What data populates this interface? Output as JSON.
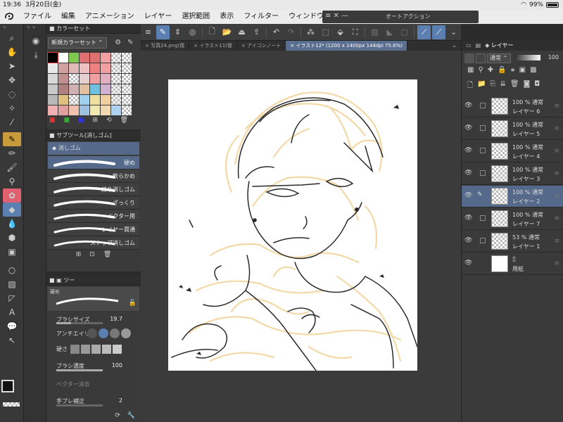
{
  "status": {
    "time": "19:36",
    "date": "3月20日(金)",
    "battery": "99%"
  },
  "menu": [
    "ファイル",
    "編集",
    "アニメーション",
    "レイヤー",
    "選択範囲",
    "表示",
    "フィルター",
    "ウィンドウ"
  ],
  "auto_action": {
    "title": "オートアクション"
  },
  "tabs": [
    {
      "label": "写真24.png(復",
      "active": false
    },
    {
      "label": "イラスト11(復",
      "active": false
    },
    {
      "label": "アイコンノート",
      "active": false
    },
    {
      "label": "イラスト12* (1200 x 1400px 144dpi 75.6%)",
      "active": true
    }
  ],
  "color_set": {
    "title": "カラーセット",
    "selected": "新規カラーセット",
    "swatches": [
      "#000000",
      "#ffffff",
      "#7ec850",
      "#e07070",
      "#e07070",
      "#f0a0a0",
      "checker",
      "checker",
      "#e8e8e8",
      "#d0a0a0",
      "#e0b8b8",
      "#f0c0c0",
      "#f08080",
      "#f0a0a0",
      "checker",
      "checker",
      "#d8d8d8",
      "#c09090",
      "checker",
      "#e8d0d0",
      "#f0a0a0",
      "#e0b0c0",
      "checker",
      "checker",
      "#c8c8c8",
      "#b08080",
      "#d0b0b0",
      "#e0c0a0",
      "#70c0e0",
      "#d0b0d0",
      "checker",
      "checker",
      "#b8b8b8",
      "#e0c080",
      "checker",
      "#a0d0f0",
      "#f0e0a0",
      "#f0d0a0",
      "checker",
      "checker",
      "#f0b0b0",
      "#e0a0a0",
      "#f0c0b0",
      "#a0c0e0",
      "#f0e8b0",
      "#f0d8b0",
      "#b0d0f0",
      "checker"
    ]
  },
  "sub_tool": {
    "title": "サブツール[消しゴム]",
    "group": "消しゴム",
    "items": [
      {
        "name": "硬め",
        "selected": true
      },
      {
        "name": "軟らかめ",
        "selected": false
      },
      {
        "name": "練り消しゴム",
        "selected": false
      },
      {
        "name": "ざっくり",
        "selected": false
      },
      {
        "name": "ベクター用",
        "selected": false
      },
      {
        "name": "レイヤー貫通",
        "selected": false
      },
      {
        "name": "スナップ消しゴム",
        "selected": false
      }
    ]
  },
  "tool_property": {
    "preset": "硬め",
    "brush_size_label": "ブラシサイズ",
    "brush_size": "19.7",
    "antialias_label": "アンチエイリ",
    "hardness_label": "硬さ",
    "density_label": "ブラシ濃度",
    "density": "100",
    "vector_label": "ベクター消去",
    "stabilization_label": "手ブレ補正",
    "stabilization": "2"
  },
  "layers": {
    "title": "レイヤー",
    "blend_mode": "通常",
    "opacity": "100",
    "items": [
      {
        "opacity": "100 % 通常",
        "name": "レイヤー 6",
        "selected": false,
        "pen": false
      },
      {
        "opacity": "100 % 通常",
        "name": "レイヤー 5",
        "selected": false,
        "pen": false
      },
      {
        "opacity": "100 % 通常",
        "name": "レイヤー 4",
        "selected": false,
        "pen": false
      },
      {
        "opacity": "100 % 通常",
        "name": "レイヤー 3",
        "selected": false,
        "pen": false
      },
      {
        "opacity": "100 % 通常",
        "name": "レイヤー 2",
        "selected": true,
        "pen": true
      },
      {
        "opacity": "100 % 通常",
        "name": "レイヤー 7",
        "selected": false,
        "pen": false
      },
      {
        "opacity": "53 % 通常",
        "name": "レイヤー 1",
        "selected": false,
        "pen": false
      },
      {
        "opacity": "",
        "name": "用紙",
        "selected": false,
        "pen": false
      }
    ]
  },
  "colors": {
    "accent": "#5a7fb0",
    "active_tool": "#c89b3b",
    "sketch": "#f4d9a8",
    "line": "#2a2a2a"
  }
}
